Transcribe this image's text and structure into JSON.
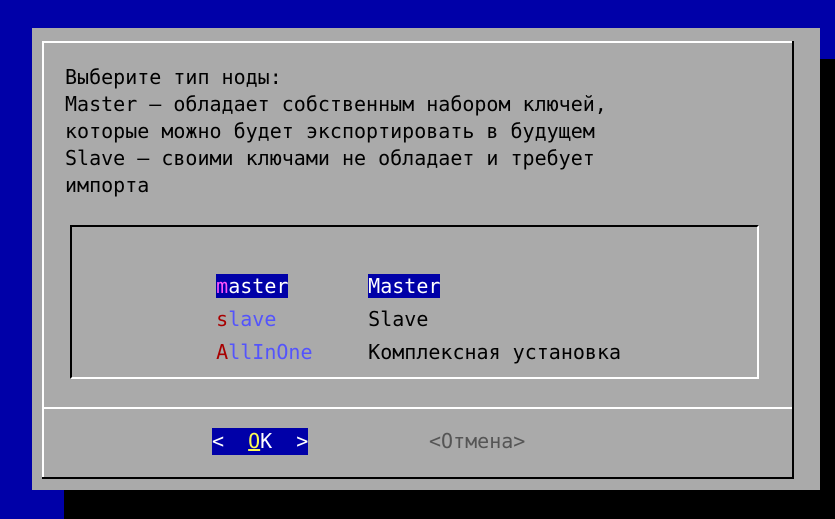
{
  "message_lines": [
    "Выберите тип ноды:",
    "Master – обладает собственным набором ключей,",
    "которые можно будет экспортировать в будущем",
    "Slave – своими ключами не обладает и требует",
    "импорта"
  ],
  "items": [
    {
      "tag_first": "m",
      "tag_rest": "aster",
      "desc": "Master",
      "selected": true
    },
    {
      "tag_first": "s",
      "tag_rest": "lave",
      "desc": "Slave",
      "selected": false
    },
    {
      "tag_first": "A",
      "tag_rest": "llInOne",
      "desc": "Комплексная установка",
      "selected": false
    }
  ],
  "buttons": {
    "ok_left": "<  ",
    "ok_hot": "O",
    "ok_rest": "K  >",
    "cancel": "<Отмена>"
  },
  "colors": {
    "screen_bg": "#0000a8",
    "dialog_bg": "#aaaaaa",
    "highlight_bg": "#0000a8",
    "hotkey": "#a80000",
    "tag_text": "#5454fc"
  }
}
